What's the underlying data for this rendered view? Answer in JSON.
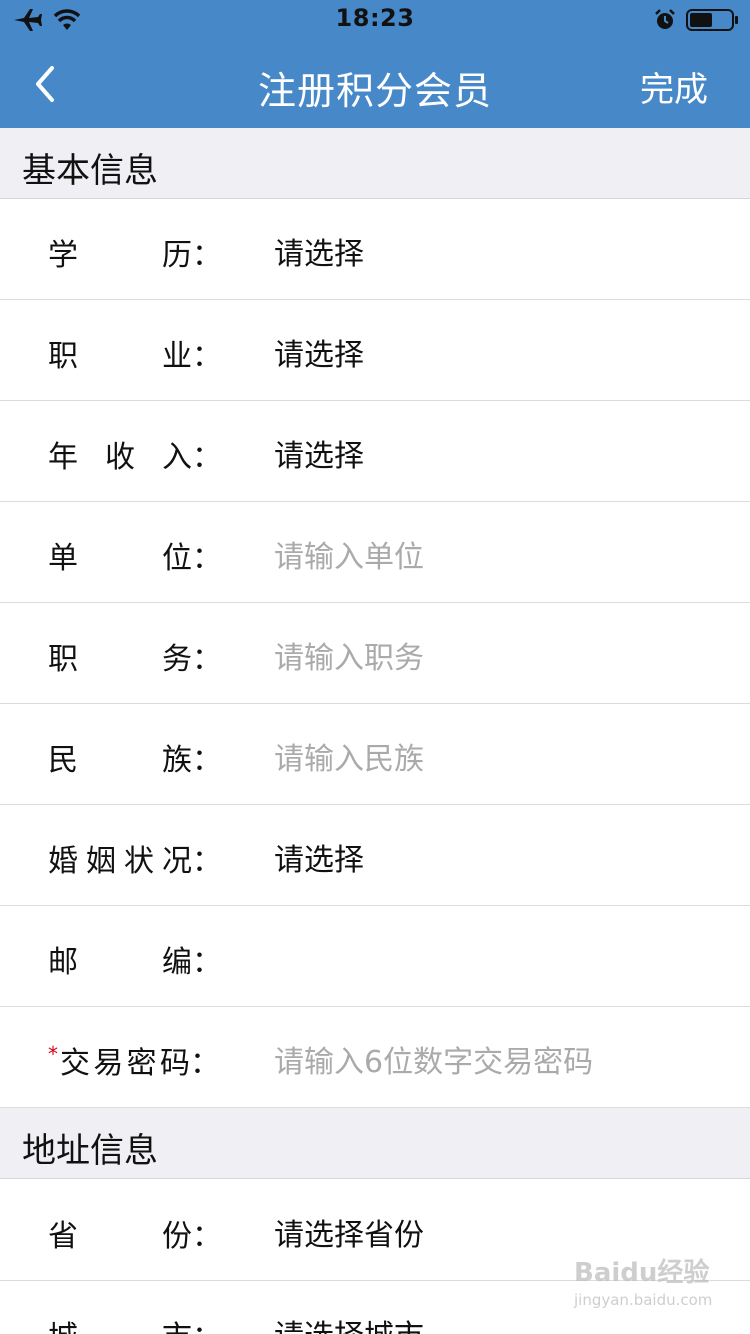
{
  "status_bar": {
    "time": "18:23",
    "left_icons": [
      "airplane-icon",
      "wifi-icon"
    ],
    "right_icons": [
      "alarm-icon",
      "battery-icon"
    ],
    "battery_level": 0.55
  },
  "nav": {
    "title": "注册积分会员",
    "back_icon": "chevron-left-icon",
    "done_label": "完成"
  },
  "sections": {
    "basic": {
      "title": "基本信息",
      "rows": [
        {
          "label": "学历",
          "value": "请选择",
          "placeholder": false
        },
        {
          "label": "职业",
          "value": "请选择",
          "placeholder": false
        },
        {
          "label": "年收入",
          "value": "请选择",
          "placeholder": false
        },
        {
          "label": "单位",
          "value": "请输入单位",
          "placeholder": true
        },
        {
          "label": "职务",
          "value": "请输入职务",
          "placeholder": true
        },
        {
          "label": "民族",
          "value": "请输入民族",
          "placeholder": true
        },
        {
          "label": "婚姻状况",
          "value": "请选择",
          "placeholder": false
        },
        {
          "label": "邮编",
          "value": "",
          "placeholder": false
        },
        {
          "label": "交易密码",
          "value": "请输入6位数字交易密码",
          "placeholder": true,
          "required": true
        }
      ]
    },
    "address": {
      "title": "地址信息",
      "rows": [
        {
          "label": "省份",
          "value": "请选择省份",
          "placeholder": false
        },
        {
          "label": "城市",
          "value": "请选择城市",
          "placeholder": false
        }
      ]
    }
  },
  "colon": "：",
  "required_mark": "*",
  "watermark": {
    "main": "Baidu经验",
    "sub": "jingyan.baidu.com"
  },
  "colors": {
    "nav_bg": "#4788C9",
    "section_bg": "#EFEFF4",
    "placeholder": "#AAAAAA",
    "required": "#D0021B"
  }
}
